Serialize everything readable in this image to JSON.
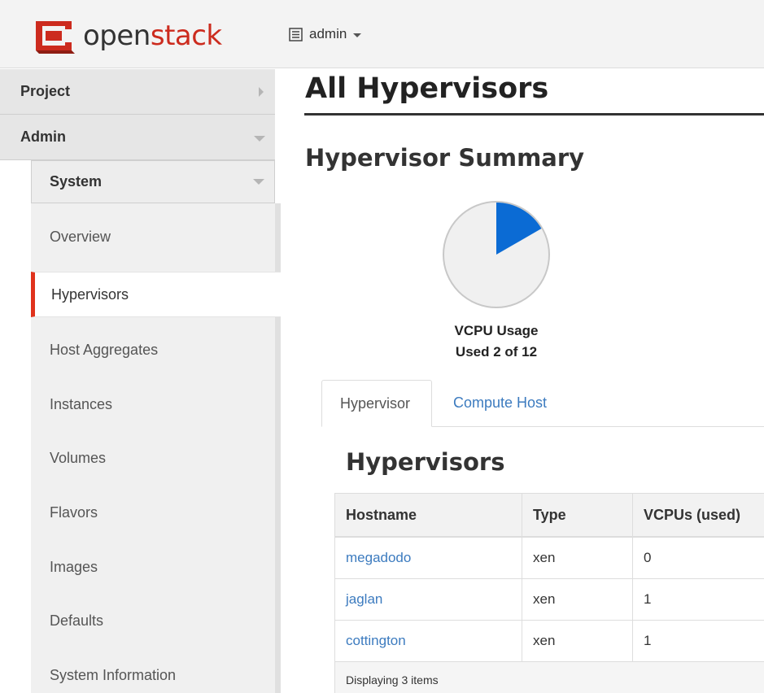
{
  "header": {
    "brand_prefix": "open",
    "brand_suffix": "stack",
    "project_name": "admin",
    "colors": {
      "brand_red": "#cc2b1e",
      "background": "#f3f3f3"
    }
  },
  "sidebar": {
    "project_label": "Project",
    "admin_label": "Admin",
    "system_label": "System",
    "items": [
      {
        "label": "Overview"
      },
      {
        "label": "Hypervisors"
      },
      {
        "label": "Host Aggregates"
      },
      {
        "label": "Instances"
      },
      {
        "label": "Volumes"
      },
      {
        "label": "Flavors"
      },
      {
        "label": "Images"
      },
      {
        "label": "Defaults"
      },
      {
        "label": "System Information"
      }
    ],
    "active_color": "#e0321c"
  },
  "main": {
    "page_title": "All Hypervisors",
    "summary_title": "Hypervisor Summary",
    "chart_data": {
      "type": "pie",
      "title": "VCPU Usage",
      "caption": "Used 2 of 12",
      "used": 2,
      "total": 12,
      "colors": {
        "used": "#0b6bd4",
        "free": "#f0f0f0"
      }
    },
    "tabs": [
      {
        "label": "Hypervisor",
        "active": true
      },
      {
        "label": "Compute Host",
        "active": false
      }
    ],
    "table_title": "Hypervisors",
    "table": {
      "headers": [
        "Hostname",
        "Type",
        "VCPUs (used)"
      ],
      "rows": [
        {
          "hostname": "megadodo",
          "type": "xen",
          "vcpus_used": "0"
        },
        {
          "hostname": "jaglan",
          "type": "xen",
          "vcpus_used": "1"
        },
        {
          "hostname": "cottington",
          "type": "xen",
          "vcpus_used": "1"
        }
      ],
      "footer": "Displaying 3 items"
    }
  }
}
